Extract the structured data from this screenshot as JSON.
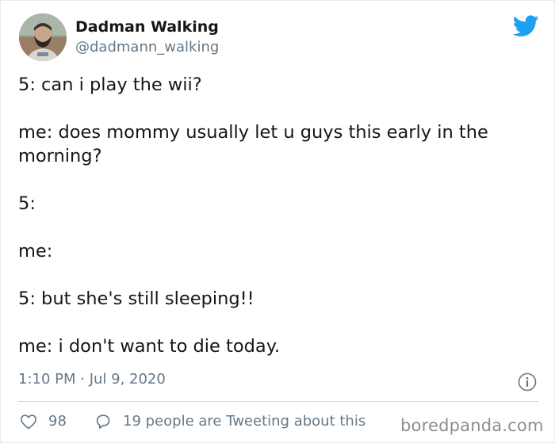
{
  "author": {
    "display_name": "Dadman Walking",
    "handle": "@dadmann_walking"
  },
  "tweet": {
    "lines": [
      "5: can i play the wii?",
      "me: does mommy usually let u guys this early in the",
      "morning?",
      "5:",
      "me:",
      "5: but she's still sleeping!!",
      "me: i don't want to die today."
    ],
    "timestamp": "1:10 PM · Jul 9, 2020"
  },
  "actions": {
    "like_count": "98",
    "tweeting_text": "19 people are Tweeting about this"
  },
  "watermark": "boredpanda.com",
  "icons": {
    "brand": "twitter-bird-icon",
    "info": "info-icon",
    "like": "heart-icon",
    "reply": "reply-bubble-icon"
  },
  "colors": {
    "twitter_blue": "#1da1f2",
    "text_primary": "#14171a",
    "text_secondary": "#657786",
    "divider": "#ccd6dd"
  }
}
